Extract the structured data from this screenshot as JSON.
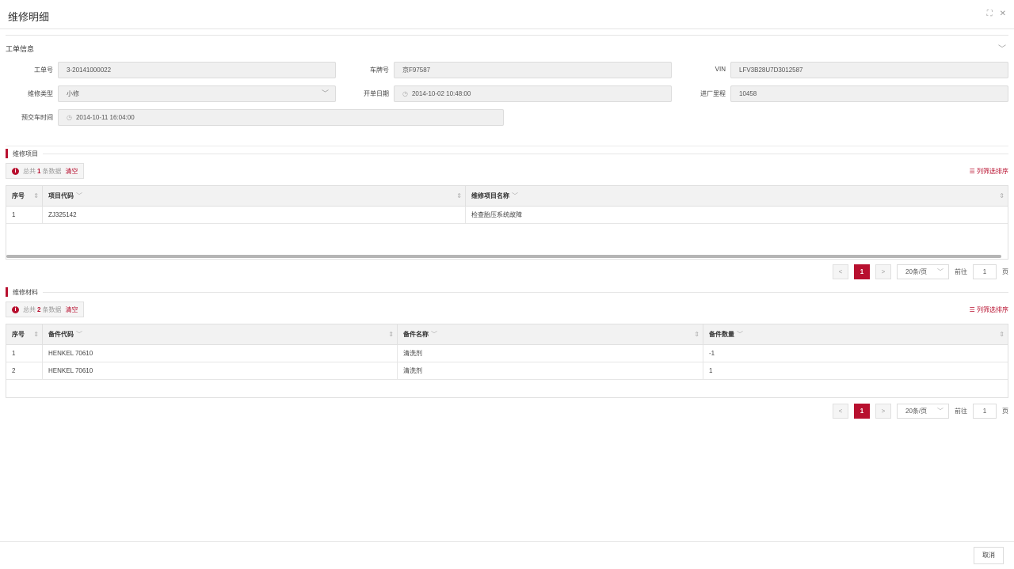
{
  "window": {
    "title": "维修明细",
    "expand_icon": "⛶",
    "close_icon": "✕"
  },
  "work_order": {
    "section_title": "工单信息",
    "fields": {
      "order_no": {
        "label": "工单号",
        "value": "3-20141000022"
      },
      "plate_no": {
        "label": "车牌号",
        "value": "京F97587"
      },
      "vin": {
        "label": "VIN",
        "value": "LFV3B28U7D3012587"
      },
      "repair_type": {
        "label": "维修类型",
        "value": "小修"
      },
      "open_date": {
        "label": "开单日期",
        "value": "2014-10-02 10:48:00"
      },
      "mileage": {
        "label": "进厂里程",
        "value": "10458"
      },
      "delivery_time": {
        "label": "预交车时间",
        "value": "2014-10-11 16:04:00"
      }
    }
  },
  "repair_items": {
    "title": "维修项目",
    "count_prefix": "总共",
    "count": "1",
    "count_suffix": "条数据",
    "clear_label": "清空",
    "col_filter_label": "列筛选排序",
    "columns": [
      "序号",
      "项目代码",
      "维修项目名称"
    ],
    "rows": [
      {
        "seq": "1",
        "code": "ZJ325142",
        "name": "检查胎压系统故障"
      }
    ]
  },
  "repair_materials": {
    "title": "维修材料",
    "count_prefix": "总共",
    "count": "2",
    "count_suffix": "条数据",
    "clear_label": "清空",
    "col_filter_label": "列筛选排序",
    "columns": [
      "序号",
      "备件代码",
      "备件名称",
      "备件数量"
    ],
    "rows": [
      {
        "seq": "1",
        "code": "HENKEL 70610",
        "name": "清洗剂",
        "qty": "-1"
      },
      {
        "seq": "2",
        "code": "HENKEL 70610",
        "name": "清洗剂",
        "qty": "1"
      }
    ]
  },
  "pager": {
    "prev": "<",
    "current": "1",
    "next": ">",
    "page_size": "20条/页",
    "goto_prefix": "前往",
    "goto_value": "1",
    "goto_suffix": "页"
  },
  "footer": {
    "cancel_label": "取消"
  }
}
